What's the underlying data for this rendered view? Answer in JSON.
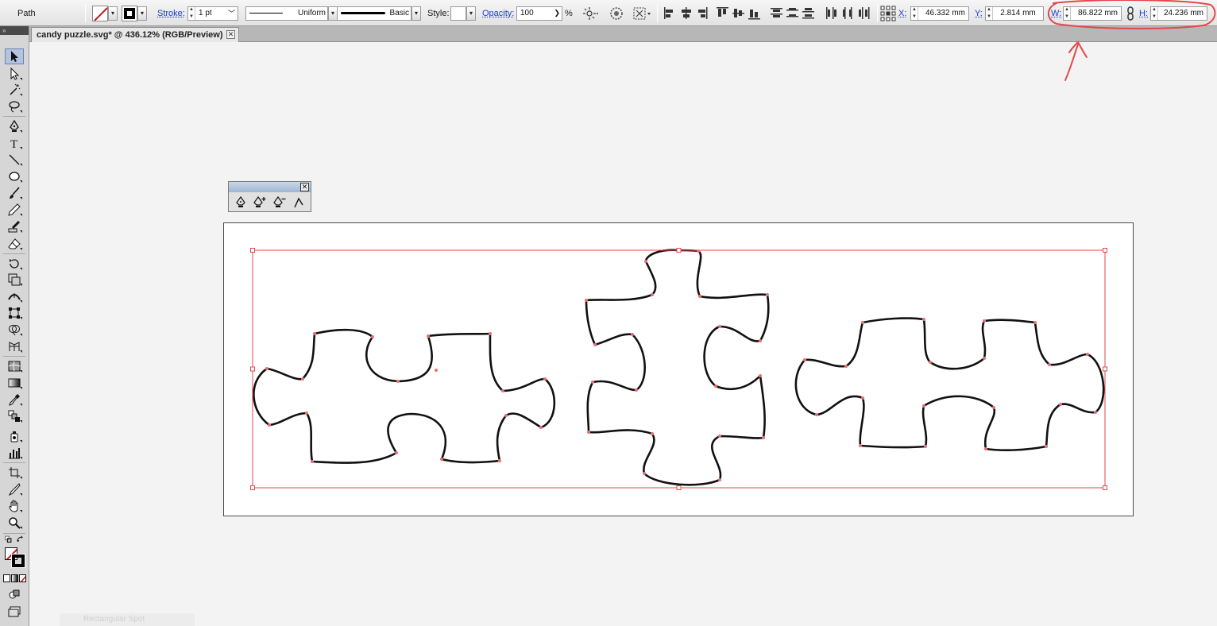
{
  "control_bar": {
    "selection_type": "Path",
    "stroke_label": "Stroke:",
    "stroke_weight": "1 pt",
    "variable_width": "Uniform",
    "brush": "Basic",
    "style_label": "Style:",
    "opacity_label": "Opacity:",
    "opacity_value": "100",
    "opacity_unit": "%",
    "x_label": "X:",
    "x_value": "46.332 mm",
    "y_label": "Y:",
    "y_value": "2.814 mm",
    "w_label": "W:",
    "w_value": "86.822 mm",
    "h_label": "H:",
    "h_value": "24.236 mm"
  },
  "document": {
    "tab_title": "candy puzzle.svg* @ 436.12% (RGB/Preview)"
  },
  "colors": {
    "annotation": "#e4474a",
    "selection": "#e4474a",
    "link_blue": "#1c3cd8",
    "artboard": "#ffffff",
    "canvas": "#f3f3f3"
  },
  "tools": [
    "selection-tool",
    "direct-selection-tool",
    "magic-wand-tool",
    "lasso-tool",
    "pen-tool",
    "type-tool",
    "line-segment-tool",
    "ellipse-tool",
    "paintbrush-tool",
    "pencil-tool",
    "blob-brush-tool",
    "eraser-tool",
    "rotate-tool",
    "scale-tool",
    "width-tool",
    "free-transform-tool",
    "shape-builder-tool",
    "perspective-grid-tool",
    "mesh-tool",
    "gradient-tool",
    "eyedropper-tool",
    "blend-tool",
    "symbol-sprayer-tool",
    "column-graph-tool",
    "artboard-tool",
    "slice-tool",
    "hand-tool",
    "zoom-tool"
  ],
  "pen_panel": {
    "tools": [
      "pen-icon",
      "add-anchor-point-icon",
      "delete-anchor-point-icon",
      "convert-anchor-point-icon"
    ]
  },
  "status_ghost": "Rectangular Spot"
}
